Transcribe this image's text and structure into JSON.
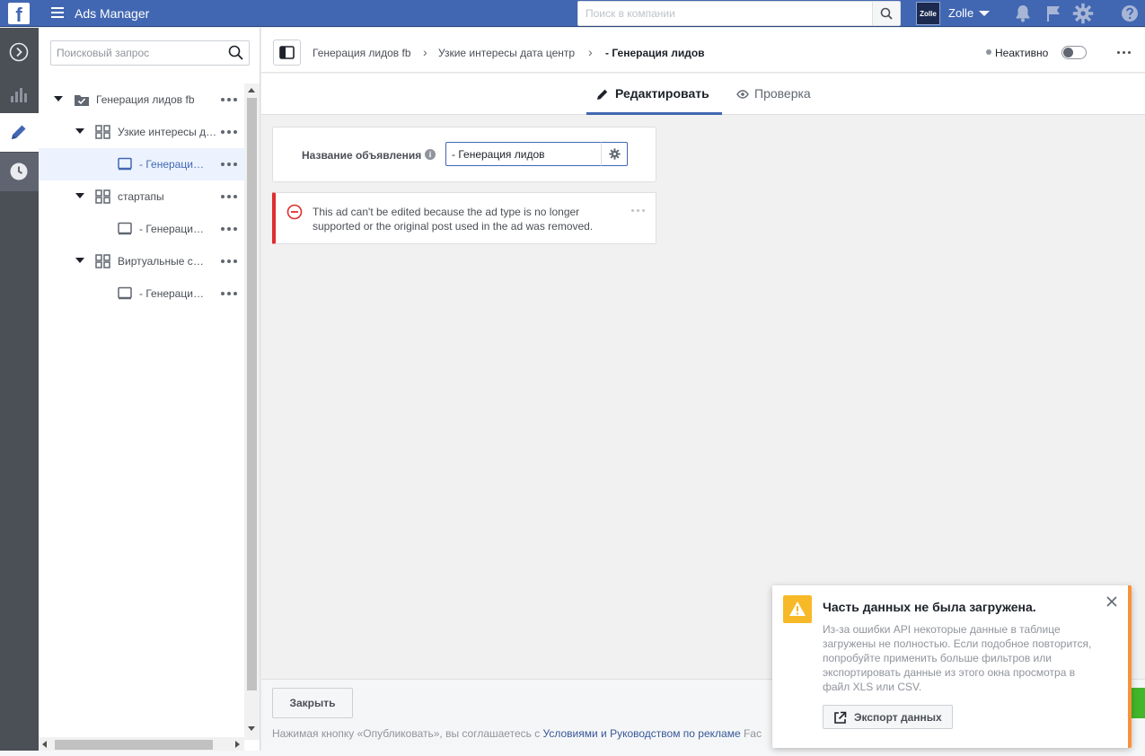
{
  "topbar": {
    "app_title": "Ads Manager",
    "search_placeholder": "Поиск в компании",
    "account_avatar_text": "Zolle",
    "account_name": "Zolle"
  },
  "tree": {
    "search_placeholder": "Поисковый запрос",
    "rows": [
      {
        "label": "Генерация лидов fb",
        "kind": "campaign",
        "level": 0
      },
      {
        "label": "Узкие интересы дата центр",
        "kind": "adset",
        "level": 1
      },
      {
        "label": "- Генерация лидов",
        "kind": "ad",
        "level": 2,
        "selected": true
      },
      {
        "label": "стартапы",
        "kind": "adset",
        "level": 1
      },
      {
        "label": "- Генерация лидов",
        "kind": "ad",
        "level": 2
      },
      {
        "label": "Виртуальные серверы",
        "kind": "adset",
        "level": 1
      },
      {
        "label": "- Генерация лидов",
        "kind": "ad",
        "level": 2
      }
    ]
  },
  "breadcrumb": {
    "campaign": "Генерация лидов fb",
    "adset": "Узкие интересы дата центр",
    "current": "- Генерация лидов"
  },
  "status": {
    "label": "Неактивно",
    "enabled": false
  },
  "tabs": {
    "edit": "Редактировать",
    "review": "Проверка"
  },
  "ad_name": {
    "label": "Название объявления",
    "value": "- Генерация лидов"
  },
  "error": {
    "message": "This ad can't be edited because the ad type is no longer supported or the original post used in the ad was removed."
  },
  "footer": {
    "close_label": "Закрыть",
    "terms_prefix": "Нажимая кнопку «Опубликовать», вы соглашаетесь с ",
    "terms_link": "Условиями и Руководством по рекламе",
    "terms_suffix": " Fac"
  },
  "toast": {
    "title": "Часть данных не была загружена.",
    "body": "Из-за ошибки API некоторые данные в таблице загружены не полностью. Если подобное повторится, попробуйте применить больше фильтров или экспортировать данные из этого окна просмотра в файл XLS или CSV.",
    "export_label": "Экспорт данных"
  },
  "colors": {
    "brand": "#4267b2",
    "error": "#e02d2d",
    "warning": "#f7b928",
    "toast_accent": "#f7923b",
    "publish": "#42b72a"
  }
}
